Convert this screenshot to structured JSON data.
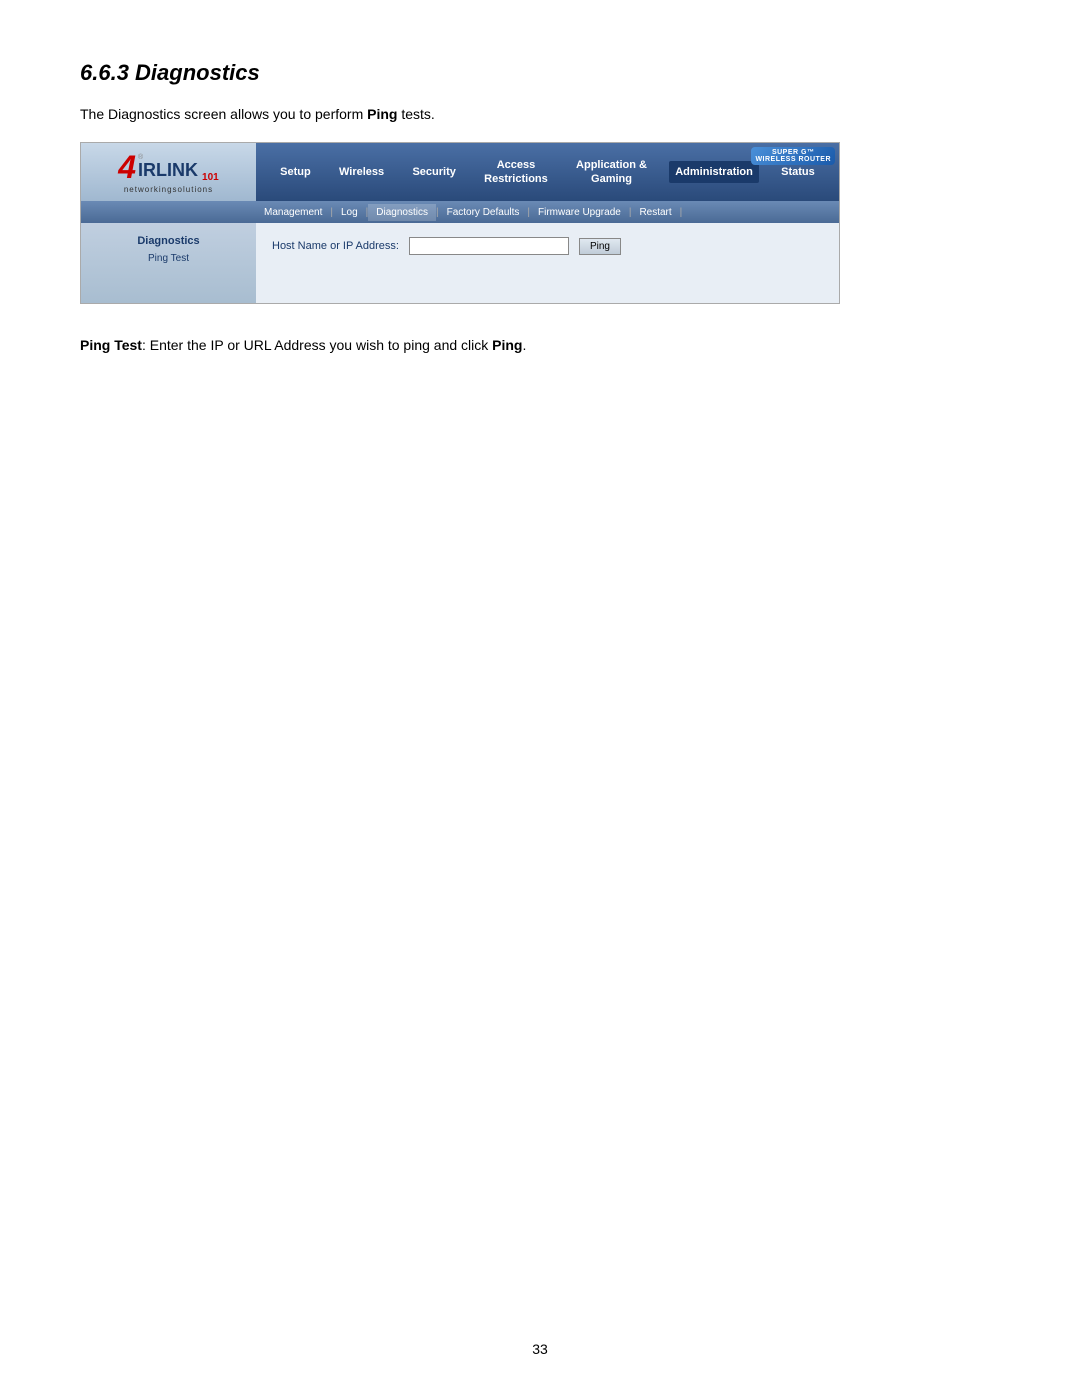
{
  "page": {
    "number": "33"
  },
  "section": {
    "title": "6.6.3 Diagnostics",
    "intro": "The Diagnostics screen allows you to perform ",
    "intro_bold": "Ping",
    "intro_end": " tests."
  },
  "router": {
    "logo": {
      "number_4": "4",
      "irlink": "IRLINK",
      "superscript": "®",
      "number_101": "101",
      "networking": "networkingsolutions"
    },
    "super_g": {
      "line1": "SUPER G™",
      "line2": "WIRELESS ROUTER"
    },
    "nav": {
      "items": [
        {
          "label": "Setup"
        },
        {
          "label": "Wireless"
        },
        {
          "label": "Security"
        },
        {
          "label": "Access\nRestrictions"
        },
        {
          "label": "Application &\nGaming"
        },
        {
          "label": "Administration"
        },
        {
          "label": "Status"
        }
      ]
    },
    "subnav": {
      "items": [
        {
          "label": "Management"
        },
        {
          "label": "Log"
        },
        {
          "label": "Diagnostics"
        },
        {
          "label": "Factory Defaults"
        },
        {
          "label": "Firmware Upgrade"
        },
        {
          "label": "Restart"
        }
      ]
    },
    "sidebar": {
      "section": "Diagnostics",
      "item": "Ping Test"
    },
    "main": {
      "ping_label": "Host Name or IP Address:",
      "ping_button": "Ping"
    }
  },
  "description": {
    "label_bold": "Ping Test",
    "text": ": Enter the IP or URL Address you wish to ping and click ",
    "ping_bold": "Ping",
    "end": "."
  }
}
